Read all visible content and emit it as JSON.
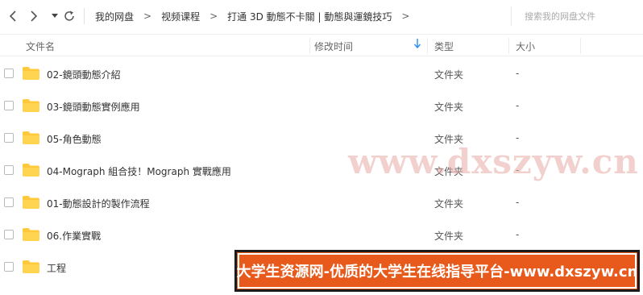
{
  "toolbar": {
    "back_icon": "chevron-left-icon",
    "forward_icon": "chevron-right-icon",
    "dropdown_icon": "caret-down-icon",
    "refresh_icon": "refresh-icon"
  },
  "breadcrumb": [
    "我的网盘",
    "视频课程",
    "打通 3D 動態不卡關 | 動態與運鏡技巧"
  ],
  "breadcrumb_separator": ">",
  "search": {
    "placeholder": "搜索我的网盘文件"
  },
  "columns": {
    "name": "文件名",
    "modified": "修改时间",
    "type": "类型",
    "size": "大小",
    "sort_icon": "arrow-down-icon"
  },
  "files": [
    {
      "name": "02-鏡頭動態介紹",
      "type": "文件夹",
      "size": "-"
    },
    {
      "name": "03-鏡頭動態實例應用",
      "type": "文件夹",
      "size": "-"
    },
    {
      "name": "05-角色動態",
      "type": "文件夹",
      "size": "-"
    },
    {
      "name": "04-Mograph 組合技！Mograph 實戰應用",
      "type": "文件夹",
      "size": "-"
    },
    {
      "name": "01-動態設計的製作流程",
      "type": "文件夹",
      "size": "-"
    },
    {
      "name": "06.作業實戰",
      "type": "文件夹",
      "size": "-"
    },
    {
      "name": "工程",
      "type": "",
      "size": ""
    }
  ],
  "watermark": "www.dxszyw.cn",
  "banner": "大学生资源网-优质的大学生在线指导平台-www.dxszyw.cn",
  "colors": {
    "folder": "#ffc83d",
    "accent": "#2a8cf0",
    "banner_bg": "#e85a1b"
  }
}
